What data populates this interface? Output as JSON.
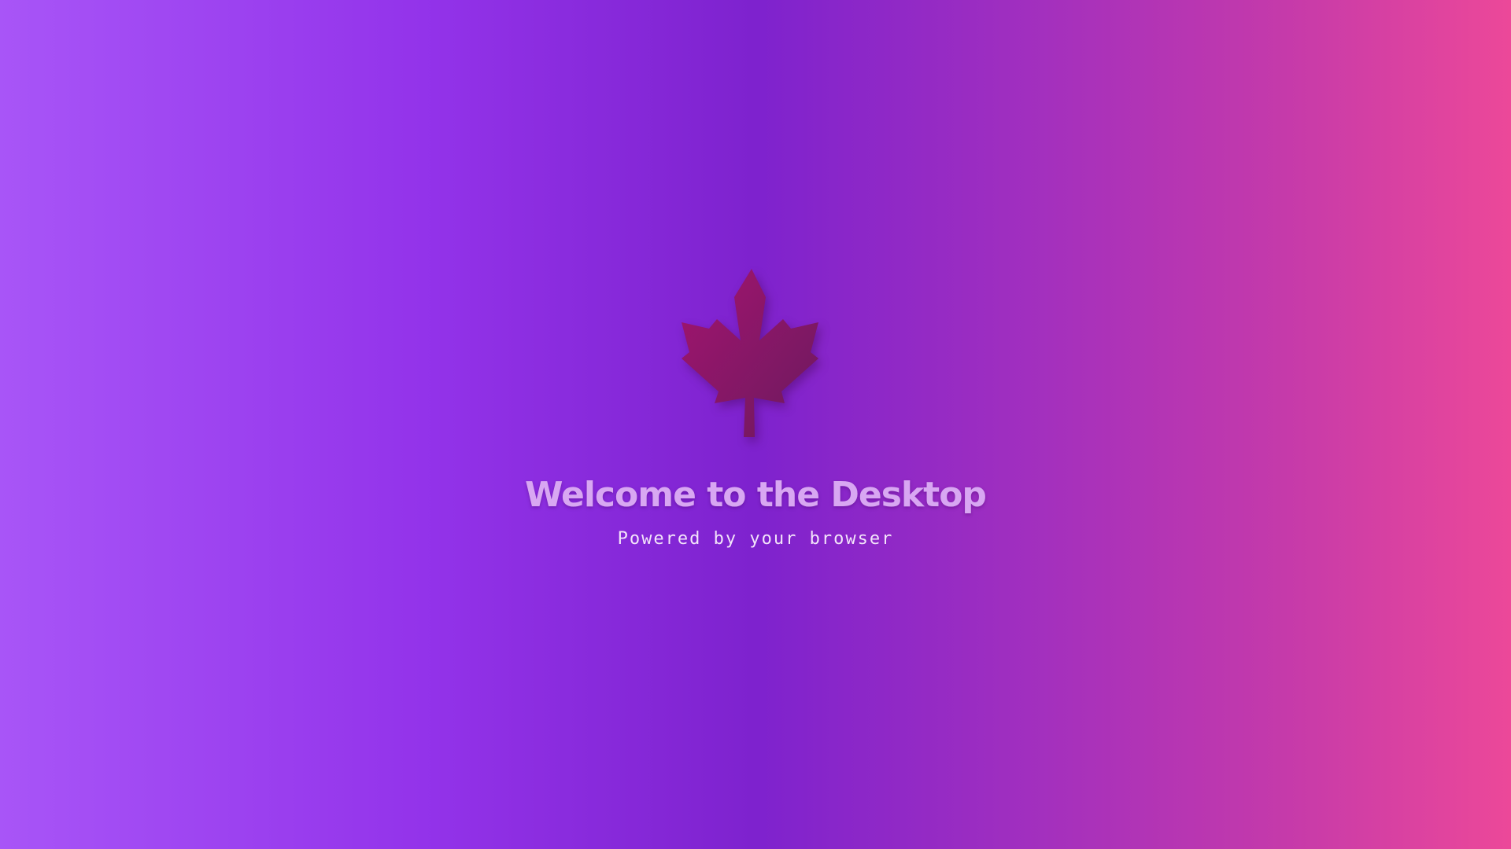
{
  "desktop": {
    "logo_icon": "maple-leaf-icon",
    "title": "Welcome to the Desktop",
    "subtitle": "Powered by your browser"
  },
  "colors": {
    "gradient_left": "#a855f7",
    "gradient_mid": "#7e22ce",
    "gradient_right": "#ec4899",
    "leaf_light": "#a3146f",
    "leaf_dark": "#6b1a5e",
    "title": "#d8a7f2",
    "subtitle": "#f3e4fa"
  }
}
